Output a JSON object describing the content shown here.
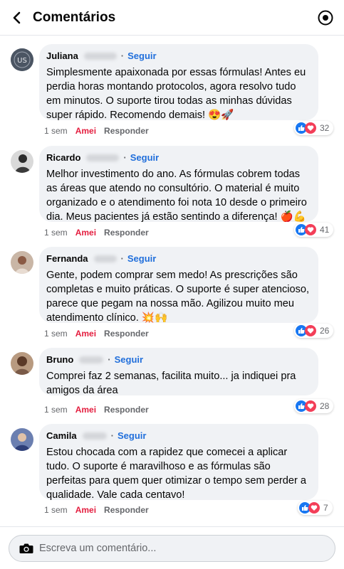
{
  "header": {
    "title": "Comentários"
  },
  "actions": {
    "liked_label": "Amei",
    "reply_label": "Responder",
    "follow_label": "Seguir"
  },
  "colors": {
    "follow": "#216fdb",
    "liked": "#e41e3f",
    "bubble": "#f0f2f5"
  },
  "comments": [
    {
      "name": "Juliana",
      "text": "Simplesmente apaixonada por essas fórmulas! Antes eu perdia horas montando protocolos, agora resolvo tudo em minutos. O suporte tirou todas as minhas dúvidas super rápido. Recomendo demais! 😍🚀",
      "time": "1 sem",
      "reactions": "32",
      "avatar_icon": "initials-avatar-icon"
    },
    {
      "name": "Ricardo",
      "text": "Melhor investimento do ano. As fórmulas cobrem todas as áreas que atendo no consultório. O material é muito organizado e o atendimento foi nota 10 desde o primeiro dia. Meus pacientes já estão sentindo a diferença! 🍎💪",
      "time": "1 sem",
      "reactions": "41",
      "avatar_icon": "photo-avatar-icon"
    },
    {
      "name": "Fernanda",
      "text": "Gente, podem comprar sem medo! As prescrições são completas e muito práticas. O suporte é super atencioso, parece que pegam na nossa mão. Agilizou muito meu atendimento clínico. 💥🙌",
      "time": "1 sem",
      "reactions": "26",
      "avatar_icon": "photo-avatar-icon"
    },
    {
      "name": "Bruno",
      "text": "Comprei faz 2 semanas, facilita muito... ja indiquei pra amigos da área",
      "time": "1 sem",
      "reactions": "28",
      "avatar_icon": "photo-avatar-icon"
    },
    {
      "name": "Camila",
      "text": "Estou chocada com a rapidez que comecei a aplicar tudo. O suporte é maravilhoso e as fórmulas são perfeitas para quem quer otimizar o tempo sem perder a qualidade. Vale cada centavo!",
      "time": "1 sem",
      "reactions": "7",
      "avatar_icon": "photo-avatar-icon"
    }
  ],
  "composer": {
    "placeholder": "Escreva um comentário..."
  }
}
